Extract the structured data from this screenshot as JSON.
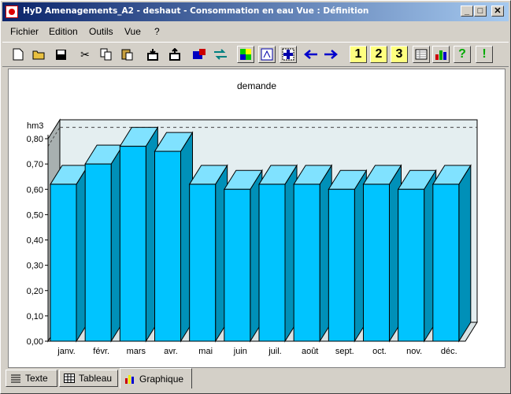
{
  "window": {
    "title": "HyD Amenagements_A2 - deshaut - Consommation en eau Vue  : Définition",
    "controls": {
      "minimize": "_",
      "maximize": "□",
      "close": "✕"
    }
  },
  "menu": [
    "Fichier",
    "Edition",
    "Outils",
    "Vue",
    "?"
  ],
  "toolbar": {
    "icons": [
      "new-icon",
      "open-icon",
      "save-icon",
      "cut-icon",
      "copy-icon",
      "paste-icon",
      "import-icon",
      "export-icon",
      "plugin-icon",
      "exchange-icon",
      "grid-color-icon",
      "fit-icon",
      "select-icon",
      "arrow-left-icon",
      "arrow-right-icon",
      "view-1-icon",
      "view-2-icon",
      "view-3-icon",
      "table-view-icon",
      "chart-view-icon",
      "help-icon",
      "alert-icon"
    ],
    "view_labels": [
      "1",
      "2",
      "3"
    ]
  },
  "chart_data": {
    "type": "bar",
    "title": "demande",
    "ylabel": "hm3",
    "categories": [
      "janv.",
      "févr.",
      "mars",
      "avr.",
      "mai",
      "juin",
      "juil.",
      "août",
      "sept.",
      "oct.",
      "nov.",
      "déc."
    ],
    "values": [
      0.62,
      0.7,
      0.77,
      0.75,
      0.62,
      0.6,
      0.62,
      0.62,
      0.6,
      0.62,
      0.6,
      0.62
    ],
    "ylim": [
      0,
      0.8
    ],
    "yticks": [
      "0,00",
      "0,10",
      "0,20",
      "0,30",
      "0,40",
      "0,50",
      "0,60",
      "0,70",
      "0,80"
    ],
    "reference_line": 0.77,
    "style": "3d",
    "bar_color": "#00c4ff",
    "bar_top_color": "#80e2ff",
    "bar_side_color": "#0090b8",
    "wall_color": "#e4eef0"
  },
  "tabs": [
    {
      "label": "Texte",
      "icon": "text-lines-icon",
      "active": false
    },
    {
      "label": "Tableau",
      "icon": "table-icon",
      "active": false
    },
    {
      "label": "Graphique",
      "icon": "chart-icon",
      "active": true
    }
  ]
}
